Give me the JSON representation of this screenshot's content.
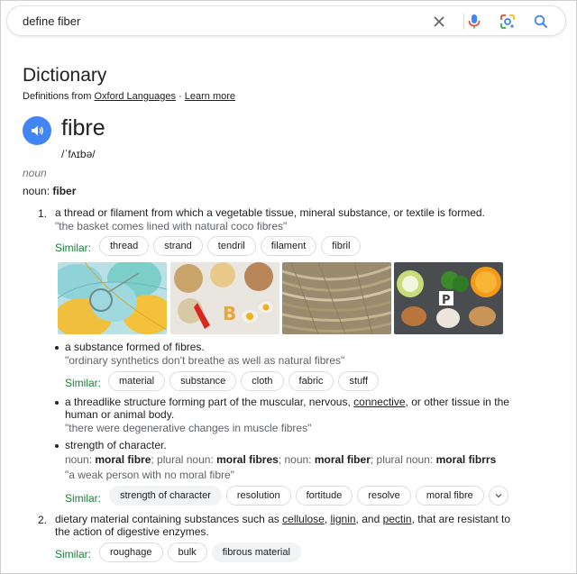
{
  "search": {
    "query": "define fiber"
  },
  "dictionary": {
    "title": "Dictionary",
    "source_prefix": "Definitions from ",
    "source_name": "Oxford Languages",
    "source_sep": " · ",
    "learn_more": "Learn more",
    "word": "fibre",
    "phonetic": "/ˈfʌɪbə/",
    "part_of_speech": "noun",
    "noun_label": "noun: ",
    "noun_word": "fiber"
  },
  "senses": {
    "s1": {
      "number": "1.",
      "definition": "a thread or filament from which a vegetable tissue, mineral substance, or textile is formed.",
      "example": "\"the basket comes lined with natural coco fibres\"",
      "similar_label": "Similar:",
      "similar": [
        "thread",
        "strand",
        "tendril",
        "filament",
        "fibril"
      ]
    },
    "sub1": {
      "definition": "a substance formed of fibres.",
      "example": "\"ordinary synthetics don't breathe as well as natural fibres\"",
      "similar_label": "Similar:",
      "similar": [
        "material",
        "substance",
        "cloth",
        "fabric",
        "stuff"
      ]
    },
    "sub2": {
      "def_a": "a threadlike structure forming part of the muscular, nervous, ",
      "def_link": "connective",
      "def_b": ", or other tissue in the",
      "def_c": "human or animal body.",
      "example": "\"there were degenerative changes in muscle fibres\""
    },
    "sub3": {
      "definition": "strength of character.",
      "forms": {
        "l1": "noun: ",
        "b1": "moral fibre",
        "l2": "; plural noun: ",
        "b2": "moral fibres",
        "l3": "; noun: ",
        "b3": "moral fiber",
        "l4": "; plural noun: ",
        "b4": "moral fibrrs"
      },
      "example": "\"a weak person with no moral fibre\"",
      "similar_label": "Similar:",
      "similar": [
        "strength of character",
        "resolution",
        "fortitude",
        "resolve",
        "moral fibre"
      ]
    },
    "s2": {
      "number": "2.",
      "def_a": "dietary material containing substances such as ",
      "link1": "cellulose",
      "sep1": ", ",
      "link2": "lignin",
      "sep2": ", and ",
      "link3": "pectin",
      "def_b": ", that are resistant to",
      "def_c": "the action of digestive enzymes.",
      "similar_label": "Similar:",
      "similar": [
        "roughage",
        "bulk",
        "fibrous material"
      ]
    }
  },
  "images": {
    "labels": [
      "B",
      "P"
    ]
  },
  "icons": {
    "clear": "close-icon",
    "mic": "microphone-icon",
    "lens": "google-lens-icon",
    "search": "search-icon",
    "speaker": "speaker-icon",
    "expand": "chevron-down-icon"
  },
  "colors": {
    "accent": "#4285f4",
    "similar_green": "#188038",
    "example_grey": "#5f6368"
  }
}
